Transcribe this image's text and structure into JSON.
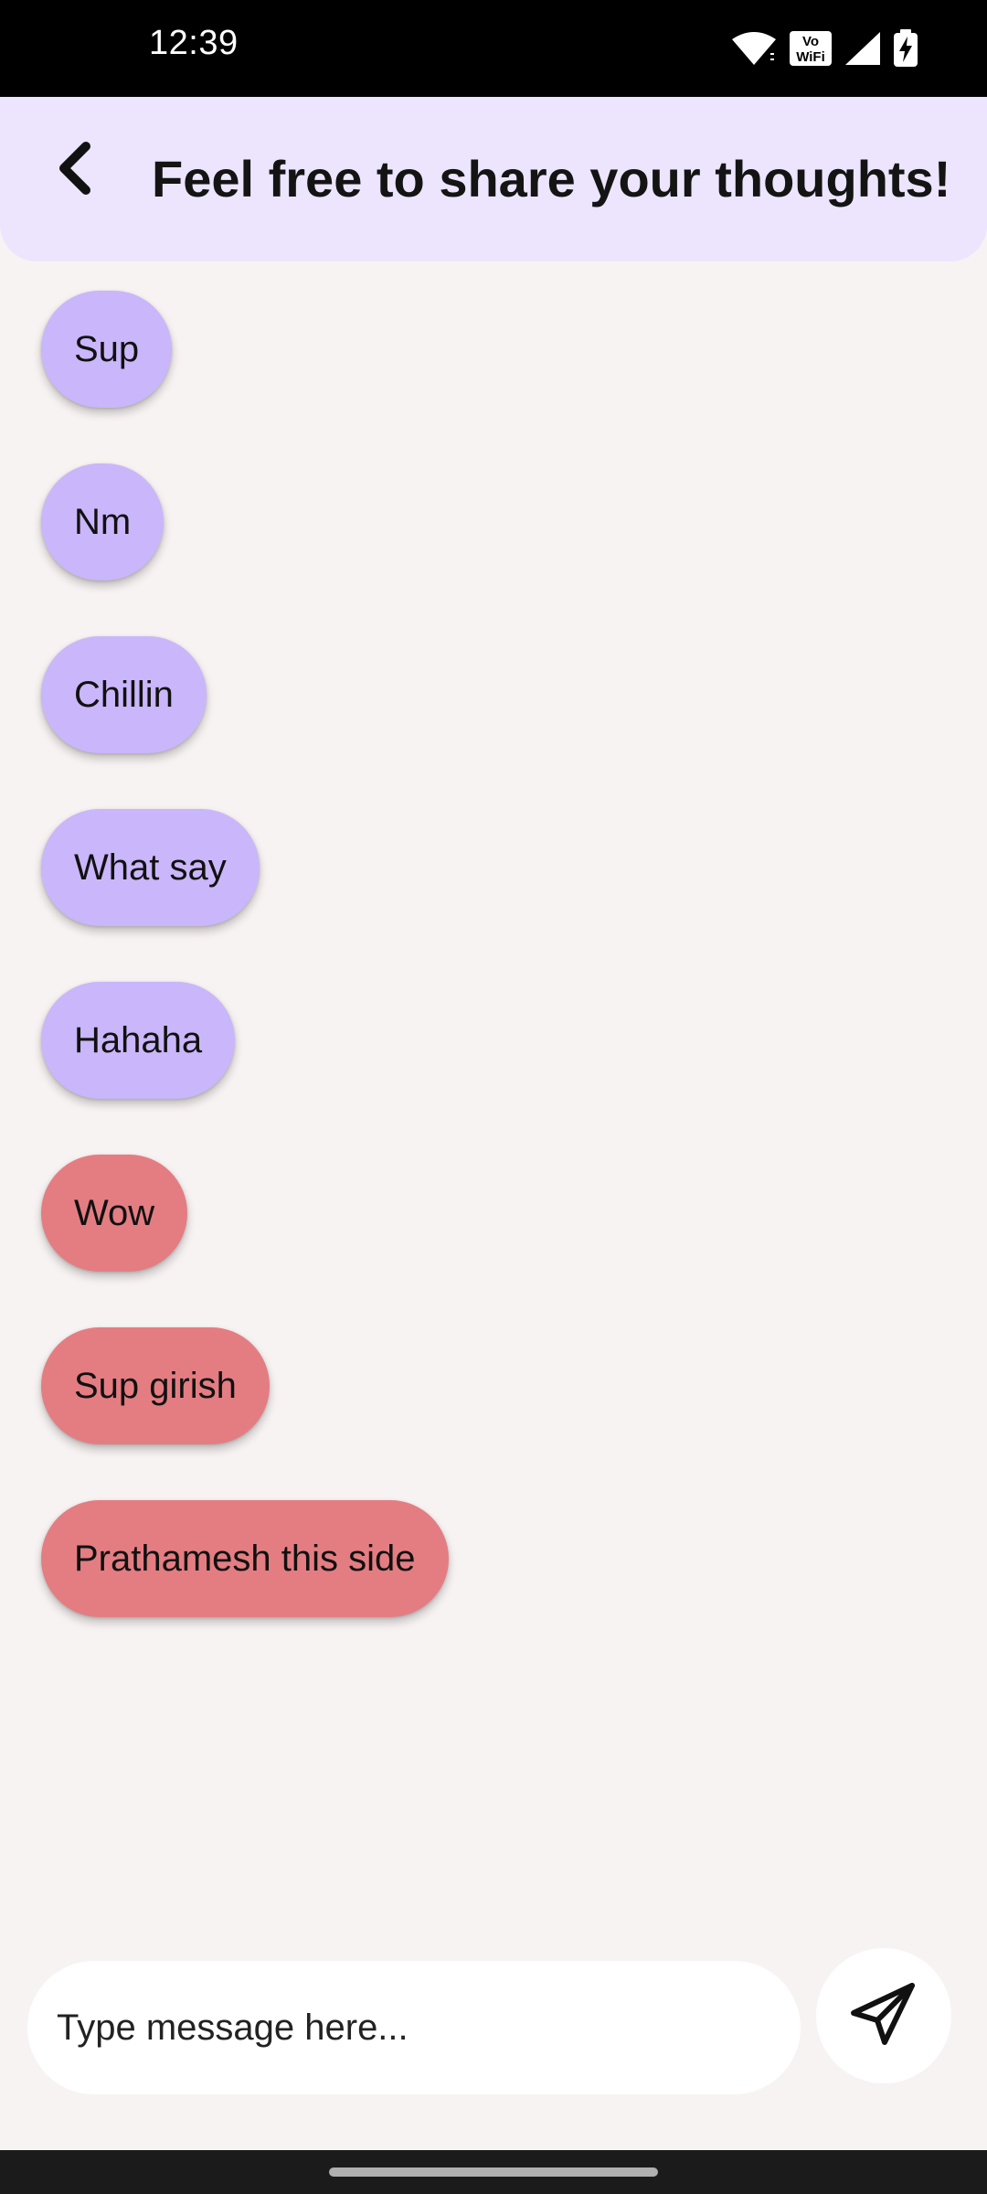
{
  "status_bar": {
    "time": "12:39",
    "icons": [
      "wifi-icon",
      "vowifi-icon",
      "cell-signal-icon",
      "battery-charging-icon"
    ],
    "vowifi_top": "Vo",
    "vowifi_bottom": "WiFi"
  },
  "header": {
    "back_icon": "chevron-left-icon",
    "title": "Feel free to share your thoughts!"
  },
  "messages": [
    {
      "text": "Sup",
      "color": "purple"
    },
    {
      "text": "Nm",
      "color": "purple"
    },
    {
      "text": "Chillin",
      "color": "purple"
    },
    {
      "text": "What say",
      "color": "purple"
    },
    {
      "text": "Hahaha",
      "color": "purple"
    },
    {
      "text": "Wow",
      "color": "red"
    },
    {
      "text": "Sup girish",
      "color": "red"
    },
    {
      "text": "Prathamesh this side",
      "color": "red"
    }
  ],
  "composer": {
    "placeholder": "Type message here...",
    "value": "",
    "send_icon": "paper-plane-icon"
  },
  "colors": {
    "background": "#f8f3f3",
    "header": "#ece5fd",
    "bubble_purple": "#cab6fa",
    "bubble_red": "#e47d82"
  }
}
